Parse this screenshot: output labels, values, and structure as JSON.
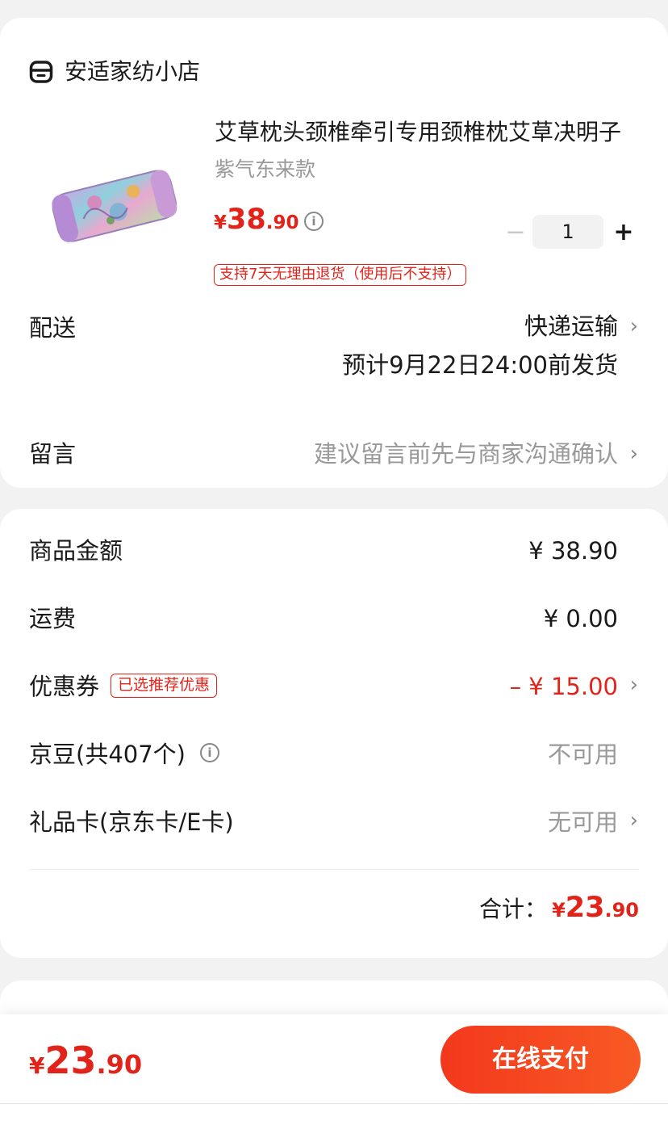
{
  "shop": {
    "name": "安适家纺小店",
    "icon": "store-icon"
  },
  "product": {
    "title": "艾草枕头颈椎牵引专用颈椎枕艾草决明子",
    "spec": "紫气东来款",
    "price": {
      "currency": "¥",
      "integer": "38",
      "decimal": ".90"
    },
    "price_info_icon": "i",
    "quantity": {
      "minus": "−",
      "value": "1",
      "plus": "+"
    },
    "return_tag": "支持7天无理由退货（使用后不支持）"
  },
  "delivery": {
    "label": "配送",
    "method": "快递运输",
    "estimate": "预计9月22日24:00前发货",
    "chevron": "›"
  },
  "message": {
    "label": "留言",
    "placeholder": "建议留言前先与商家沟通确认",
    "chevron": "›"
  },
  "fees": {
    "goods": {
      "label": "商品金额",
      "value": "¥ 38.90"
    },
    "shipping": {
      "label": "运费",
      "value": "¥ 0.00"
    },
    "coupon": {
      "label": "优惠券",
      "tag": "已选推荐优惠",
      "value": "– ¥ 15.00",
      "chevron": "›"
    },
    "beans": {
      "label": "京豆(共407个)",
      "info_icon": "i",
      "value": "不可用"
    },
    "giftcard": {
      "label": "礼品卡(京东卡/E卡)",
      "value": "无可用",
      "chevron": "›"
    },
    "total": {
      "label": "合计：",
      "currency": "¥",
      "integer": "23",
      "decimal": ".90"
    }
  },
  "bottom_bar": {
    "price": {
      "currency": "¥",
      "integer": "23",
      "decimal": ".90"
    },
    "pay_button": "在线支付"
  },
  "colors": {
    "accent": "#e2231a",
    "button_gradient_start": "#f3381d",
    "button_gradient_end": "#f85a24",
    "background": "#f2f2f2"
  }
}
